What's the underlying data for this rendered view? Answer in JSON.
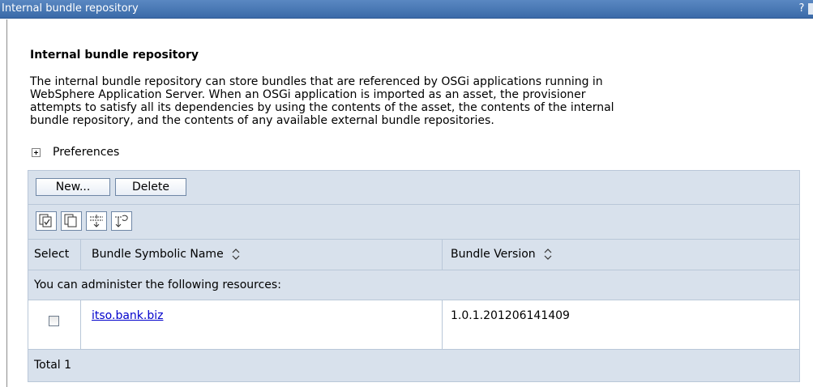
{
  "window": {
    "title": "Internal bundle repository",
    "help_label": "?"
  },
  "page": {
    "heading": "Internal bundle repository",
    "description_lines": [
      "The internal bundle repository can store bundles that are referenced by OSGi applications running in",
      "WebSphere Application Server. When an OSGi application is imported as an asset, the provisioner",
      "attempts to satisfy all its dependencies by using the contents of the asset, the contents of the internal",
      "bundle repository, and the contents of any available external bundle repositories."
    ],
    "preferences_label": "Preferences"
  },
  "toolbar": {
    "new_label": "New...",
    "delete_label": "Delete",
    "icons": [
      "select-all-icon",
      "deselect-all-icon",
      "show-filter-icon",
      "clear-filter-icon"
    ]
  },
  "table": {
    "columns": [
      "Select",
      "Bundle Symbolic Name",
      "Bundle Version"
    ],
    "message": "You can administer the following resources:",
    "rows": [
      {
        "name": "itso.bank.biz",
        "version": "1.0.1.201206141409",
        "selected": false
      }
    ],
    "total_label": "Total 1"
  }
}
